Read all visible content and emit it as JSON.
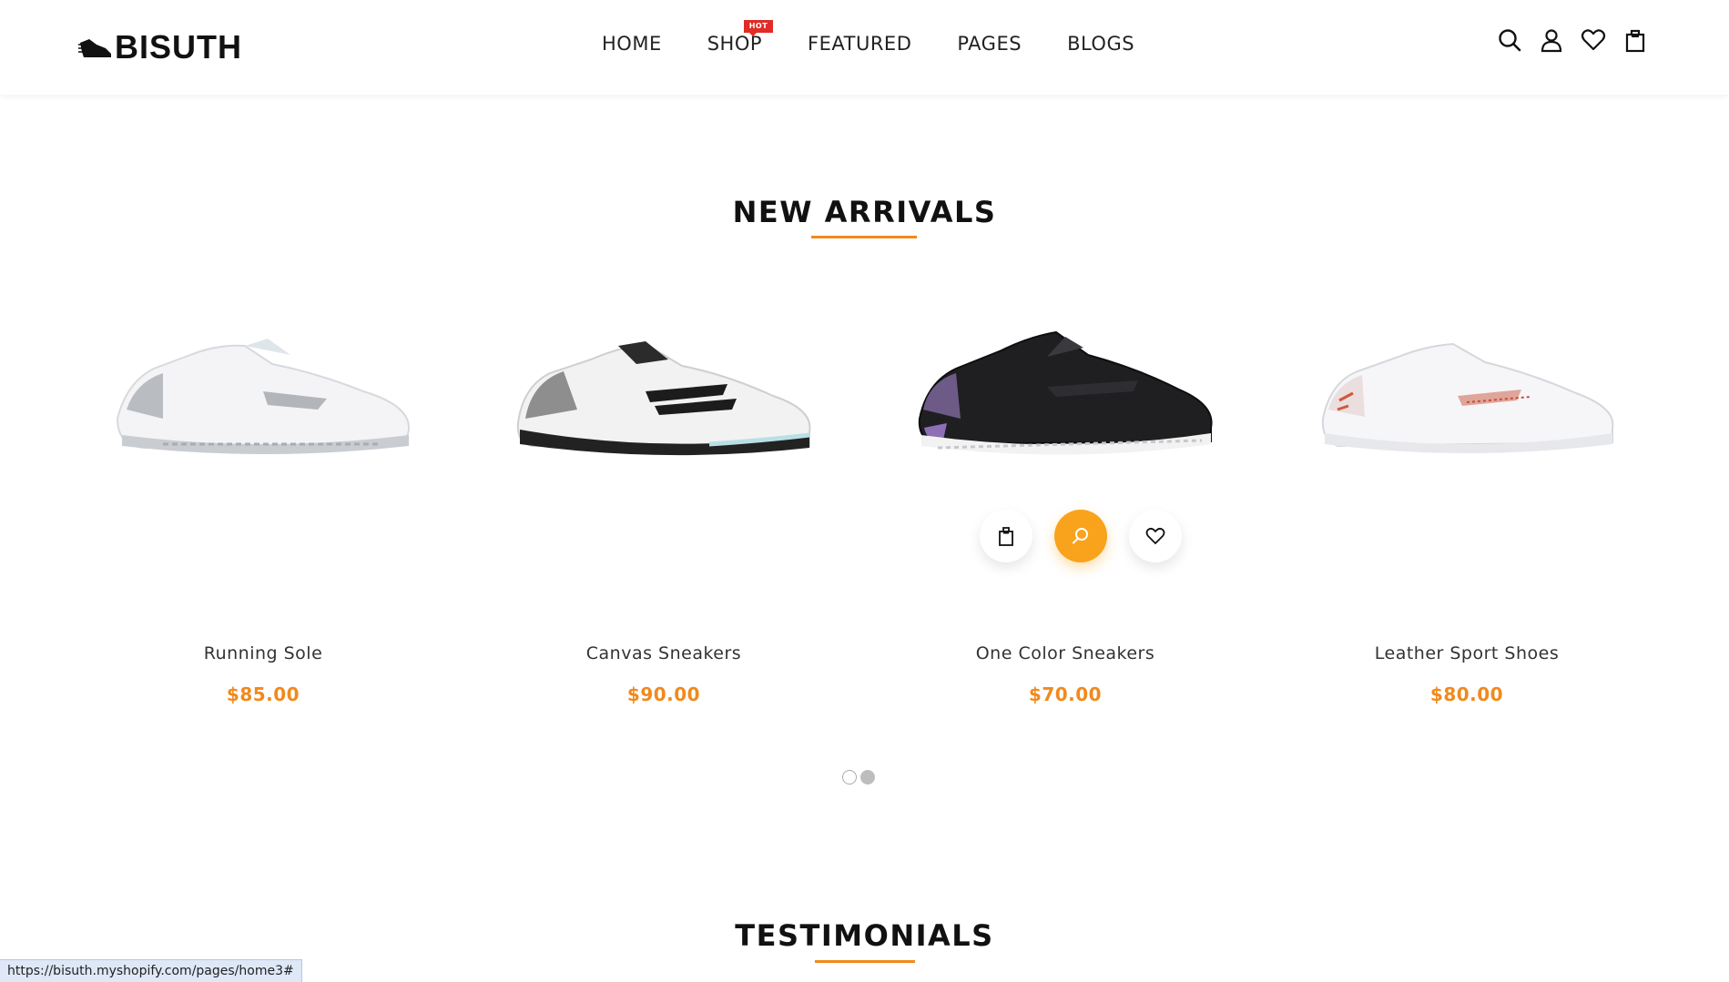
{
  "header": {
    "logo_text": "BISUTH",
    "nav": [
      {
        "label": "HOME"
      },
      {
        "label": "SHOP",
        "badge": "HOT"
      },
      {
        "label": "FEATURED"
      },
      {
        "label": "PAGES"
      },
      {
        "label": "BLOGS"
      }
    ],
    "icons": [
      "search-icon",
      "user-icon",
      "heart-icon",
      "shopping-bag-icon"
    ]
  },
  "new_arrivals": {
    "title": "NEW ARRIVALS",
    "products": [
      {
        "name": "Running Sole",
        "price": "$85.00",
        "color": "white-silver"
      },
      {
        "name": "Canvas Sneakers",
        "price": "$90.00",
        "color": "white-black"
      },
      {
        "name": "One Color Sneakers",
        "price": "$70.00",
        "color": "black"
      },
      {
        "name": "Leather Sport Shoes",
        "price": "$80.00",
        "color": "white-red"
      }
    ],
    "hover_actions": [
      "add-to-cart-icon",
      "quick-view-icon",
      "wishlist-icon"
    ],
    "pagination_dots": 2,
    "active_dot": 2
  },
  "testimonials": {
    "title": "TESTIMONIALS"
  },
  "status_bar": {
    "url": "https://bisuth.myshopify.com/pages/home3#"
  },
  "colors": {
    "accent": "#f08a1c",
    "quick_view_bg": "#f9a21b",
    "hot_badge": "#e02b27"
  }
}
